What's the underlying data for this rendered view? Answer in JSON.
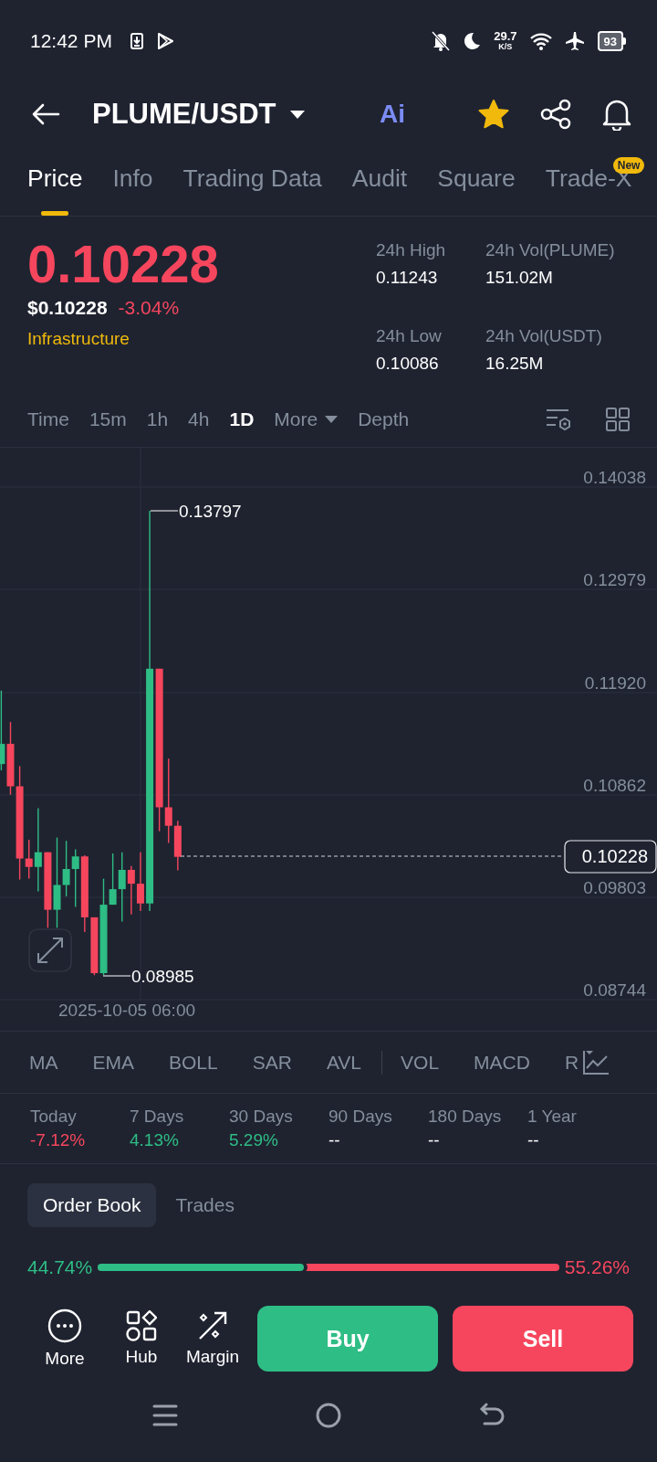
{
  "status_bar": {
    "time": "12:42 PM",
    "net_speed": "29.7",
    "net_unit": "K/S",
    "battery": "93"
  },
  "header": {
    "pair": "PLUME/USDT",
    "ai_label": "Ai",
    "favorite": true
  },
  "tabs": [
    {
      "label": "Price",
      "selected": true
    },
    {
      "label": "Info",
      "selected": false
    },
    {
      "label": "Trading Data",
      "selected": false
    },
    {
      "label": "Audit",
      "selected": false
    },
    {
      "label": "Square",
      "selected": false
    },
    {
      "label": "Trade-X",
      "selected": false,
      "badge": "New"
    }
  ],
  "price": {
    "last": "0.10228",
    "usd": "$0.10228",
    "change": "-3.04%",
    "tag": "Infrastructure"
  },
  "stats": [
    {
      "label": "24h High",
      "value": "0.11243"
    },
    {
      "label": "24h Vol(PLUME)",
      "value": "151.02M"
    },
    {
      "label": "24h Low",
      "value": "0.10086"
    },
    {
      "label": "24h Vol(USDT)",
      "value": "16.25M"
    }
  ],
  "intervals": [
    {
      "label": "Time",
      "selected": false
    },
    {
      "label": "15m",
      "selected": false
    },
    {
      "label": "1h",
      "selected": false
    },
    {
      "label": "4h",
      "selected": false
    },
    {
      "label": "1D",
      "selected": true
    },
    {
      "label": "More",
      "selected": false,
      "dropdown": true
    },
    {
      "label": "Depth",
      "selected": false
    }
  ],
  "chart": {
    "y_labels": [
      "0.14038",
      "0.12979",
      "0.11920",
      "0.10862",
      "0.09803",
      "0.08744"
    ],
    "high": "0.13797",
    "low": "0.08985",
    "last": "0.10228",
    "time": "2025-10-05 06:00"
  },
  "indicators": {
    "main": [
      "MA",
      "EMA",
      "BOLL",
      "SAR",
      "AVL"
    ],
    "sub": [
      "VOL",
      "MACD",
      "R"
    ]
  },
  "periods": [
    {
      "label": "Today",
      "value": "-7.12%",
      "color": "#f6465d"
    },
    {
      "label": "7 Days",
      "value": "4.13%",
      "color": "#2ebd85"
    },
    {
      "label": "30 Days",
      "value": "5.29%",
      "color": "#2ebd85"
    },
    {
      "label": "90 Days",
      "value": "--",
      "color": "#ffffff"
    },
    {
      "label": "180 Days",
      "value": "--",
      "color": "#ffffff"
    },
    {
      "label": "1 Year",
      "value": "--",
      "color": "#ffffff"
    }
  ],
  "book_tabs": [
    {
      "label": "Order Book",
      "selected": true
    },
    {
      "label": "Trades",
      "selected": false
    }
  ],
  "ratio": {
    "buy": "44.74%",
    "sell": "55.26%",
    "level": 0.4474
  },
  "actions": [
    {
      "label": "More",
      "kind": "more"
    },
    {
      "label": "Hub",
      "kind": "hub"
    },
    {
      "label": "Margin",
      "kind": "margin"
    }
  ],
  "trade_buttons": {
    "buy": "Buy",
    "sell": "Sell"
  }
}
